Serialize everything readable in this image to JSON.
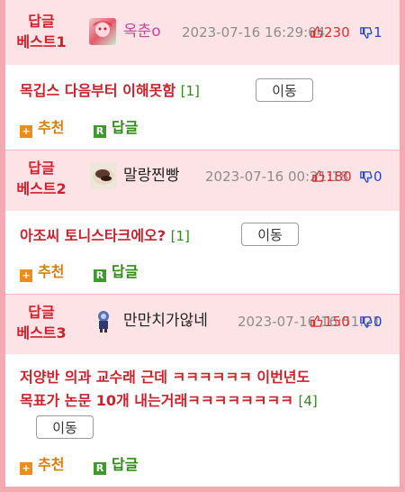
{
  "posts": [
    {
      "best_label": "답글 베스트1",
      "best_line1": "답글",
      "best_line2": "베스트1",
      "nickname": "옥춘o",
      "datetime": "2023-07-16 16:29:04",
      "upvotes": "230",
      "downvotes": "1",
      "title": "목깁스 다음부터 이해못함",
      "reply_count": "[1]",
      "move_label": "이동",
      "recommend_label": "추천",
      "reply_label": "답글"
    },
    {
      "best_line1": "답글",
      "best_line2": "베스트2",
      "nickname": "말랑찐빵",
      "datetime": "2023-07-16 00:21:18",
      "upvotes": "180",
      "downvotes": "0",
      "title": "아조씨 토니스타크에오?",
      "reply_count": "[1]",
      "move_label": "이동",
      "recommend_label": "추천",
      "reply_label": "답글"
    },
    {
      "best_line1": "답글",
      "best_line2": "베스트3",
      "nickname": "만만치가않네",
      "datetime": "2023-07-16 16:51:21",
      "upvotes": "150",
      "downvotes": "0",
      "title_line1": "저양반 의과 교수래 근데 ㅋㅋㅋㅋㅋㅋ 이번년도",
      "title_line2": "목표가 논문 10개 내는거래ㅋㅋㅋㅋㅋㅋㅋㅋ",
      "reply_count": "[4]",
      "move_label": "이동",
      "recommend_label": "추천",
      "reply_label": "답글"
    }
  ],
  "colors": {
    "accent_red": "#d0202b",
    "header_bg": "#fde3e6",
    "frame": "#f7a9b2",
    "reply_green": "#2f8a18",
    "recommend_orange": "#e07b0d"
  },
  "icons": {
    "thumb_up": "thumbs-up-icon",
    "thumb_down": "thumbs-down-icon",
    "plus": "plus-icon",
    "reply": "reply-r-icon"
  }
}
